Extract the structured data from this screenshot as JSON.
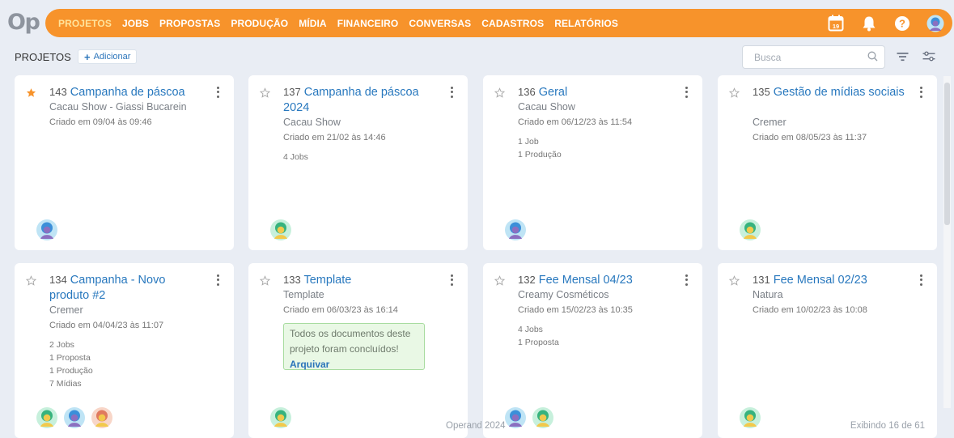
{
  "brand": {
    "logo_text": "Op"
  },
  "nav": {
    "items": [
      "PROJETOS",
      "JOBS",
      "PROPOSTAS",
      "PRODUÇÃO",
      "MÍDIA",
      "FINANCEIRO",
      "CONVERSAS",
      "CADASTROS",
      "RELATÓRIOS"
    ],
    "active": "PROJETOS",
    "calendar_day": "19",
    "icons": [
      "calendar-icon",
      "bell-icon",
      "help-icon",
      "user-avatar"
    ]
  },
  "toolbar": {
    "title": "PROJETOS",
    "add_label": "Adicionar",
    "search_placeholder": "Busca"
  },
  "projects": [
    {
      "number": "143",
      "name": "Campanha de páscoa",
      "client": "Cacau Show - Giassi Bucarein",
      "created": "Criado em 09/04 às 09:46",
      "favorite": true,
      "stats": [],
      "avatars": [
        "blue"
      ]
    },
    {
      "number": "137",
      "name": "Campanha de páscoa 2024",
      "client": "Cacau Show",
      "created": "Criado em 21/02 às 14:46",
      "favorite": false,
      "stats": [
        "4 Jobs"
      ],
      "avatars": [
        "green"
      ]
    },
    {
      "number": "136",
      "name": "Geral",
      "client": "Cacau Show",
      "created": "Criado em 06/12/23 às 11:54",
      "favorite": false,
      "stats": [
        "1 Job",
        "1 Produção"
      ],
      "avatars": [
        "blue"
      ]
    },
    {
      "number": "135",
      "name": "Gestão de mídias sociais",
      "client": "Cremer",
      "created": "Criado em 08/05/23 às 11:37",
      "favorite": false,
      "stats": [],
      "avatars": [
        "green"
      ]
    },
    {
      "number": "134",
      "name": "Campanha - Novo produto #2",
      "client": "Cremer",
      "created": "Criado em 04/04/23 às 11:07",
      "favorite": false,
      "stats": [
        "2 Jobs",
        "1 Proposta",
        "1 Produção",
        "7 Mídias"
      ],
      "avatars": [
        "green",
        "blue",
        "orange"
      ]
    },
    {
      "number": "133",
      "name": "Template",
      "client": "Template",
      "created": "Criado em 06/03/23 às 16:14",
      "favorite": false,
      "stats": [],
      "notice": {
        "text": "Todos os documentos deste projeto foram concluídos!",
        "action": "Arquivar"
      },
      "avatars": [
        "green"
      ]
    },
    {
      "number": "132",
      "name": "Fee Mensal 04/23",
      "client": "Creamy Cosméticos",
      "created": "Criado em 15/02/23 às 10:35",
      "favorite": false,
      "stats": [
        "4 Jobs",
        "1 Proposta"
      ],
      "avatars": [
        "blue",
        "green"
      ]
    },
    {
      "number": "131",
      "name": "Fee Mensal 02/23",
      "client": "Natura",
      "created": "Criado em 10/02/23 às 10:08",
      "favorite": false,
      "stats": [],
      "avatars": [
        "green"
      ]
    }
  ],
  "colors": {
    "accent": "#f7932b",
    "link": "#2878be",
    "star": "#f7932b"
  },
  "footer": {
    "text": "Operand 2024",
    "count": "Exibindo 16 de 61"
  }
}
